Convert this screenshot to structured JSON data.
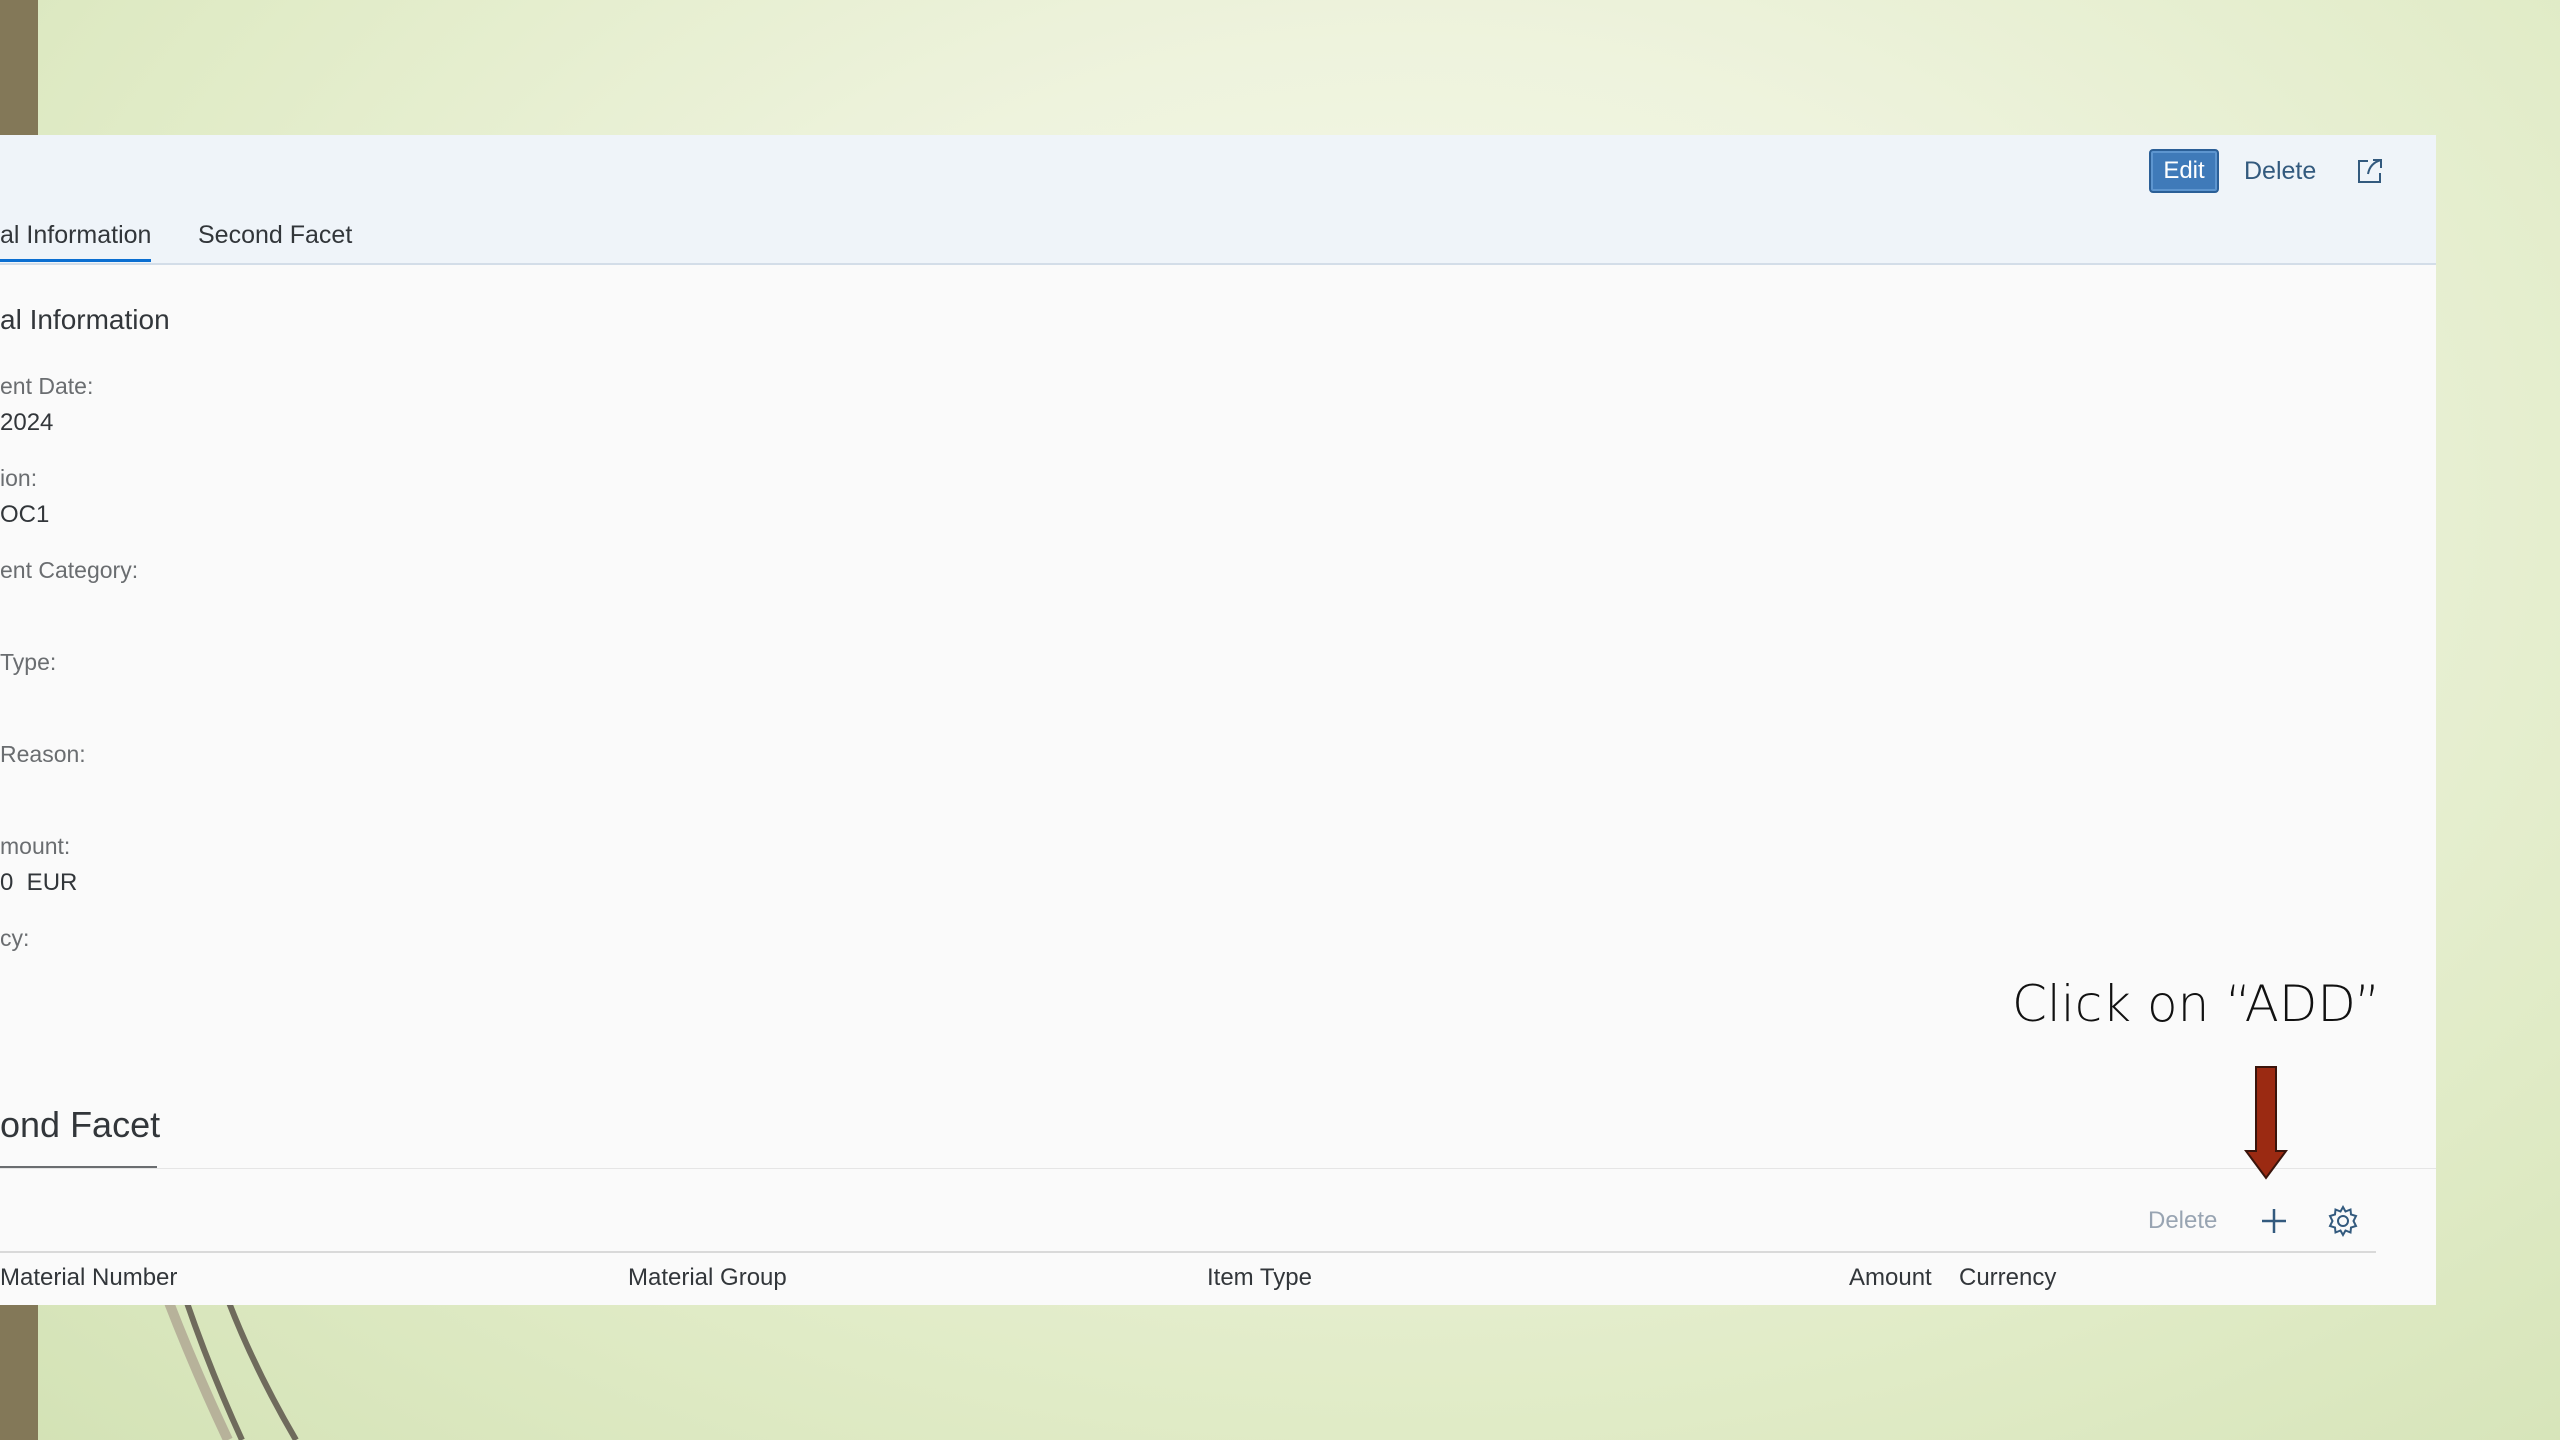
{
  "header": {
    "edit_label": "Edit",
    "delete_label": "Delete"
  },
  "tabs": [
    {
      "label": "al Information",
      "active": true
    },
    {
      "label": "Second Facet",
      "active": false
    }
  ],
  "general_section": {
    "title": "al Information",
    "fields": [
      {
        "label": "ent Date:",
        "value": "2024"
      },
      {
        "label": "ion:",
        "value": "OC1"
      },
      {
        "label": "ent Category:",
        "value": ""
      },
      {
        "label": "Type:",
        "value": ""
      },
      {
        "label": "Reason:",
        "value": ""
      },
      {
        "label": "mount:",
        "value": "0  EUR"
      },
      {
        "label": "cy:",
        "value": ""
      }
    ]
  },
  "second_facet": {
    "title": "ond Facet",
    "toolbar": {
      "delete_label": "Delete"
    },
    "columns": [
      "Material Number",
      "Material Group",
      "Item Type",
      "Amount",
      "Currency"
    ]
  },
  "annotation": {
    "text": "Click on “ADD”",
    "arrow_color": "#9b2a12"
  },
  "colors": {
    "accent": "#0a6ed1",
    "edit_button": "#3f7ab9",
    "link": "#335a7e",
    "disabled": "#98a4b2"
  }
}
